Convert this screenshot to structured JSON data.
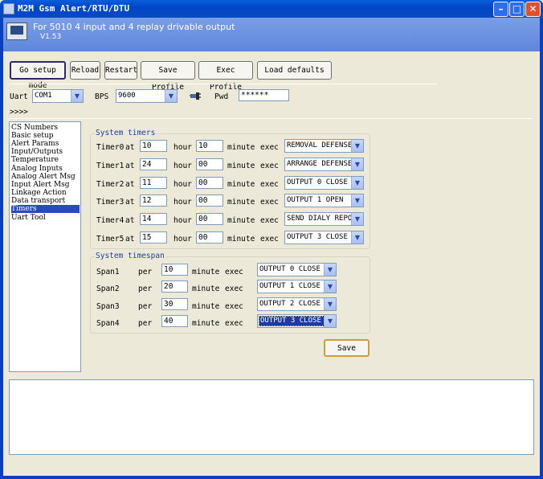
{
  "window": {
    "title": "M2M Gsm Alert/RTU/DTU"
  },
  "header": {
    "title": "For 5010 4 input and 4 replay drivable output",
    "version": "V1.53"
  },
  "toolbar": {
    "setup_mode": "Go setup mode",
    "reload": "Reload",
    "restart": "Restart",
    "save_profile": "Save Profile",
    "exec_profile": "Exec Profile",
    "load_defaults": "Load defaults"
  },
  "conn": {
    "uart_label": "Uart",
    "uart_value": "COM1",
    "bps_label": "BPS",
    "bps_value": "9600",
    "pwd_label": "Pwd",
    "pwd_value": "******",
    "arrows": ">>>>"
  },
  "menu": {
    "items": [
      "CS Numbers",
      "Basic setup",
      "Alert Params",
      "Input/Outputs",
      "Temperature",
      "Analog Inputs",
      "Analog Alert Msg",
      "Input Alert Msg",
      "Linkage Action",
      "Data transport",
      "Timers",
      "Uart Tool"
    ],
    "selected": "Timers"
  },
  "timers": {
    "group_label": "System timers",
    "at": "at",
    "hour": "hour",
    "minute": "minute",
    "exec": "exec",
    "rows": [
      {
        "label": "Timer0",
        "hour": "10",
        "minute": "10",
        "action": "REMOVAL DEFENSE"
      },
      {
        "label": "Timer1",
        "hour": "24",
        "minute": "00",
        "action": "ARRANGE DEFENSE"
      },
      {
        "label": "Timer2",
        "hour": "11",
        "minute": "00",
        "action": "OUTPUT 0 CLOSE"
      },
      {
        "label": "Timer3",
        "hour": "12",
        "minute": "00",
        "action": "OUTPUT 1 OPEN"
      },
      {
        "label": "Timer4",
        "hour": "14",
        "minute": "00",
        "action": "SEND DIALY REPOI"
      },
      {
        "label": "Timer5",
        "hour": "15",
        "minute": "00",
        "action": "OUTPUT 3 CLOSE :"
      }
    ]
  },
  "spans": {
    "group_label": "System timespan",
    "per": "per",
    "minute": "minute",
    "exec": "exec",
    "rows": [
      {
        "label": "Span1",
        "value": "10",
        "action": "OUTPUT 0 CLOSE"
      },
      {
        "label": "Span2",
        "value": "20",
        "action": "OUTPUT 1 CLOSE"
      },
      {
        "label": "Span3",
        "value": "30",
        "action": "OUTPUT 2 CLOSE :"
      },
      {
        "label": "Span4",
        "value": "40",
        "action": "OUTPUT 3 CLOSE :"
      }
    ]
  },
  "save_label": "Save",
  "log": {
    "text": ""
  }
}
